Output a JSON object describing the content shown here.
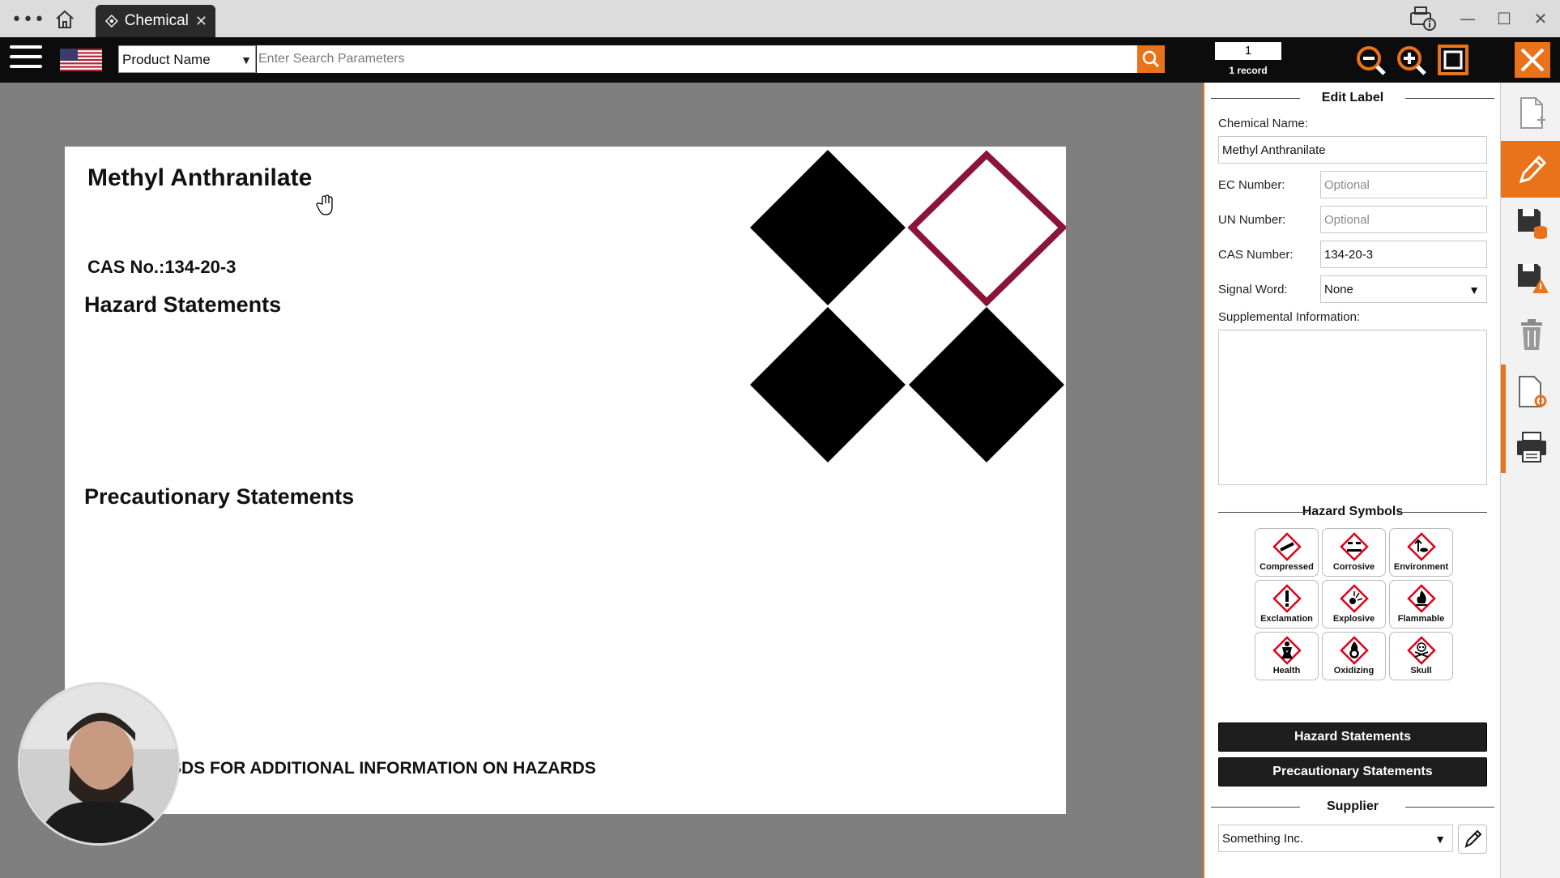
{
  "titlebar": {
    "tab_label": "Chemical",
    "icons": [
      "more-dots-icon",
      "home-icon",
      "tab-close-icon",
      "printer-info-icon",
      "minimize-icon",
      "maximize-icon",
      "window-close-icon"
    ]
  },
  "toolbar": {
    "search_field": "Product Name",
    "search_placeholder": "Enter Search Parameters",
    "record_number": "1",
    "record_count": "1 record",
    "accent_color": "#e8731a"
  },
  "label": {
    "chemical_name": "Methyl Anthranilate",
    "cas_line": "CAS No.:134-20-3",
    "hazard_heading": "Hazard Statements",
    "precautionary_heading": "Precautionary Statements",
    "footer_text": "SDS FOR ADDITIONAL INFORMATION ON HAZARDS"
  },
  "edit_panel": {
    "title": "Edit Label",
    "chemical_name_label": "Chemical Name:",
    "chemical_name_value": "Methyl Anthranilate",
    "ec_label": "EC Number:",
    "ec_placeholder": "Optional",
    "un_label": "UN Number:",
    "un_placeholder": "Optional",
    "cas_label": "CAS Number:",
    "cas_value": "134-20-3",
    "signal_label": "Signal Word:",
    "signal_value": "None",
    "supplemental_label": "Supplemental Information:",
    "hazard_symbols_title": "Hazard Symbols",
    "symbols": [
      {
        "label": "Compressed",
        "icon": "gas-cylinder-icon"
      },
      {
        "label": "Corrosive",
        "icon": "corrosion-icon"
      },
      {
        "label": "Environment",
        "icon": "environment-icon"
      },
      {
        "label": "Exclamation",
        "icon": "exclamation-icon"
      },
      {
        "label": "Explosive",
        "icon": "exploding-bomb-icon"
      },
      {
        "label": "Flammable",
        "icon": "flame-icon"
      },
      {
        "label": "Health",
        "icon": "health-hazard-icon"
      },
      {
        "label": "Oxidizing",
        "icon": "flame-over-circle-icon"
      },
      {
        "label": "Skull",
        "icon": "skull-crossbones-icon"
      }
    ],
    "hazard_button": "Hazard Statements",
    "precautionary_button": "Precautionary Statements",
    "supplier_title": "Supplier",
    "supplier_value": "Something Inc."
  },
  "rightbar": {
    "icons": [
      "new-file-icon",
      "edit-pencil-icon",
      "save-database-icon",
      "save-warning-icon",
      "trash-icon",
      "file-settings-icon",
      "printer-icon"
    ]
  }
}
